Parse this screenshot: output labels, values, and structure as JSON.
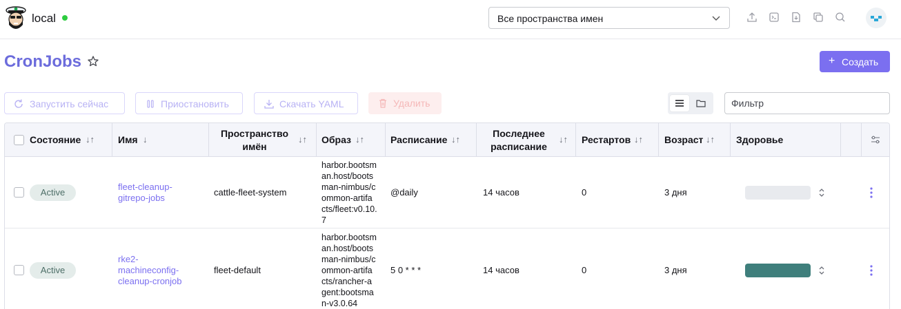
{
  "header": {
    "cluster_name": "local",
    "namespace_select": "Все пространства имен",
    "icons": [
      "import-yaml-icon",
      "kubectl-shell-icon",
      "download-kubeconfig-icon",
      "copy-kubeconfig-icon",
      "search-icon"
    ]
  },
  "page": {
    "title": "CronJobs",
    "create_label": "Создать"
  },
  "bulk_actions": {
    "run_now": "Запустить сейчас",
    "suspend": "Приостановить",
    "download_yaml": "Скачать YAML",
    "delete": "Удалить"
  },
  "filter": {
    "placeholder": "Фильтр"
  },
  "table": {
    "columns": {
      "state": "Состояние",
      "name": "Имя",
      "namespace_l1": "Пространство",
      "namespace_l2": "имён",
      "image": "Образ",
      "schedule": "Расписание",
      "last_schedule_l1": "Последнее",
      "last_schedule_l2": "расписание",
      "restarts": "Рестартов",
      "age": "Возраст",
      "health": "Здоровье"
    },
    "rows": [
      {
        "state": "Active",
        "name": "fleet-cleanup-\ngitrepo-jobs",
        "namespace": "cattle-fleet-system",
        "image": "harbor.bootsm\nan.host/boots\nman-nimbus/c\nommon-artifa\ncts/fleet:v0.10.\n7",
        "schedule": "@daily",
        "last_schedule": "14 часов",
        "restarts": "0",
        "age": "3 дня",
        "health_color": "#e8eaee"
      },
      {
        "state": "Active",
        "name": "rke2-\nmachineconfig-\ncleanup-cronjob",
        "namespace": "fleet-default",
        "image": "harbor.bootsm\nan.host/boots\nman-nimbus/c\nommon-artifa\ncts/rancher-a\ngent:bootsma\nn-v3.0.64",
        "schedule": "5 0 * * *",
        "last_schedule": "14 часов",
        "restarts": "0",
        "age": "3 дня",
        "health_color": "#3f7f7c"
      }
    ]
  },
  "colors": {
    "accent": "#7b6ff0",
    "title": "#6c6cdc",
    "status_ok": "#2ecc40"
  }
}
